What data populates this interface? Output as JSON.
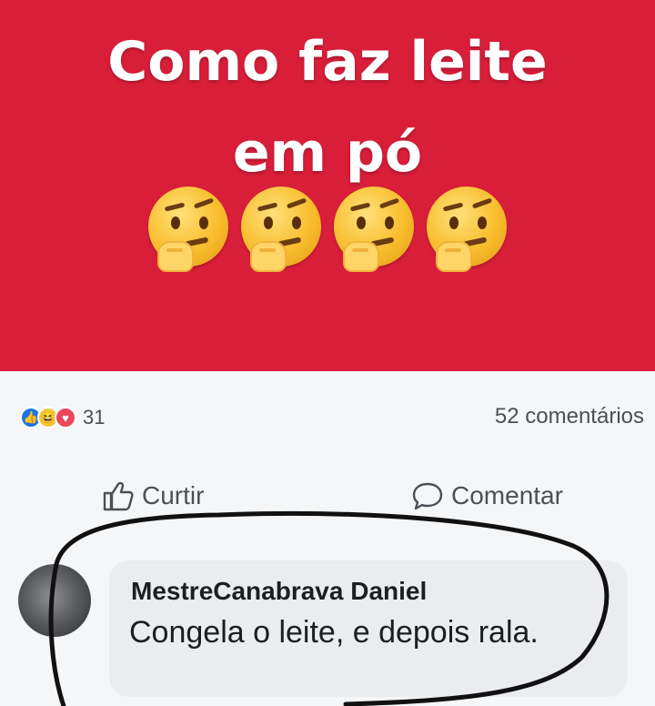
{
  "post": {
    "title": "Como faz leite\nem pó",
    "emojis": [
      "thinking-face-icon",
      "thinking-face-icon",
      "thinking-face-icon",
      "thinking-face-icon"
    ],
    "background_color": "#d91e3a"
  },
  "stats": {
    "reaction_icons": [
      "like-icon",
      "haha-icon",
      "love-icon"
    ],
    "reaction_count": "31",
    "comments_label": "52 comentários"
  },
  "actions": {
    "like_label": "Curtir",
    "comment_label": "Comentar"
  },
  "comment": {
    "author": "MestreCanabrava Daniel",
    "text": "Congela o leite, e depois rala."
  }
}
